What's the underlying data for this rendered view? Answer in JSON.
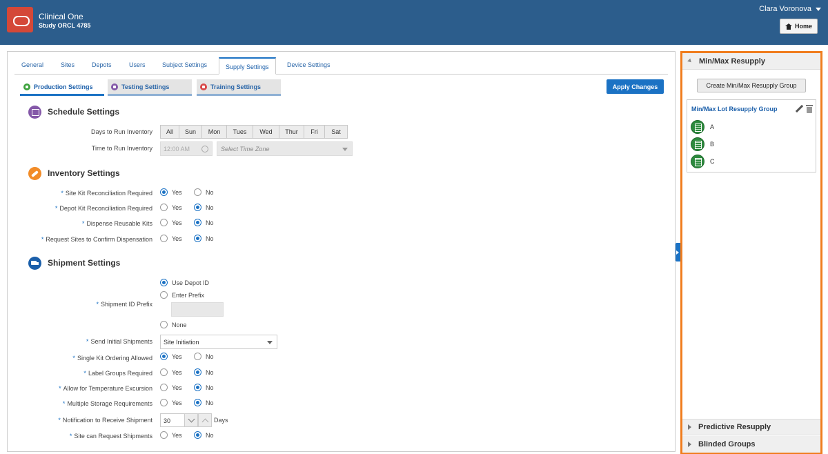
{
  "app": {
    "title": "Clinical One",
    "subtitle": "Study ORCL 4785",
    "user": "Clara Voronova",
    "home_label": "Home"
  },
  "tabs": [
    "General",
    "Sites",
    "Depots",
    "Users",
    "Subject Settings",
    "Supply Settings",
    "Device Settings"
  ],
  "active_tab": "Supply Settings",
  "subtabs": [
    "Production Settings",
    "Testing Settings",
    "Training Settings"
  ],
  "apply_label": "Apply Changes",
  "schedule": {
    "title": "Schedule Settings",
    "days_label": "Days to Run Inventory",
    "days": [
      "All",
      "Sun",
      "Mon",
      "Tues",
      "Wed",
      "Thur",
      "Fri",
      "Sat"
    ],
    "time_label": "Time to Run Inventory",
    "time_value": "12:00 AM",
    "timezone_placeholder": "Select Time Zone"
  },
  "inventory": {
    "title": "Inventory Settings",
    "rows": [
      {
        "label": "Site Kit Reconciliation Required",
        "value": "Yes"
      },
      {
        "label": "Depot Kit Reconciliation Required",
        "value": "No"
      },
      {
        "label": "Dispense Reusable Kits",
        "value": "No"
      },
      {
        "label": "Request Sites to Confirm Dispensation",
        "value": "No"
      }
    ]
  },
  "shipment": {
    "title": "Shipment Settings",
    "prefix_label": "Shipment ID Prefix",
    "prefix_options": [
      "Use Depot ID",
      "Enter Prefix",
      "None"
    ],
    "prefix_selected": "Use Depot ID",
    "send_label": "Send Initial Shipments",
    "send_value": "Site Initiation",
    "rows": [
      {
        "label": "Single Kit Ordering Allowed",
        "value": "Yes"
      },
      {
        "label": "Label Groups Required",
        "value": "No"
      },
      {
        "label": "Allow for Temperature Excursion",
        "value": "No"
      },
      {
        "label": "Multiple Storage Requirements",
        "value": "No"
      }
    ],
    "notify_label": "Notification to Receive Shipment",
    "notify_value": "30",
    "notify_unit": "Days",
    "request_label": "Site can Request Shipments",
    "request_value": "No"
  },
  "yes": "Yes",
  "no": "No",
  "right_panel": {
    "minmax_title": "Min/Max Resupply",
    "create_label": "Create Min/Max Resupply Group",
    "group_title": "Min/Max Lot Resupply Group",
    "group_items": [
      "A",
      "B",
      "C"
    ],
    "predictive_title": "Predictive Resupply",
    "blinded_title": "Blinded Groups"
  },
  "colors": {
    "header": "#2c5d8c",
    "accent": "#1b72c4",
    "panel_border": "#f07d1e",
    "kit_green": "#2d8a3e"
  }
}
